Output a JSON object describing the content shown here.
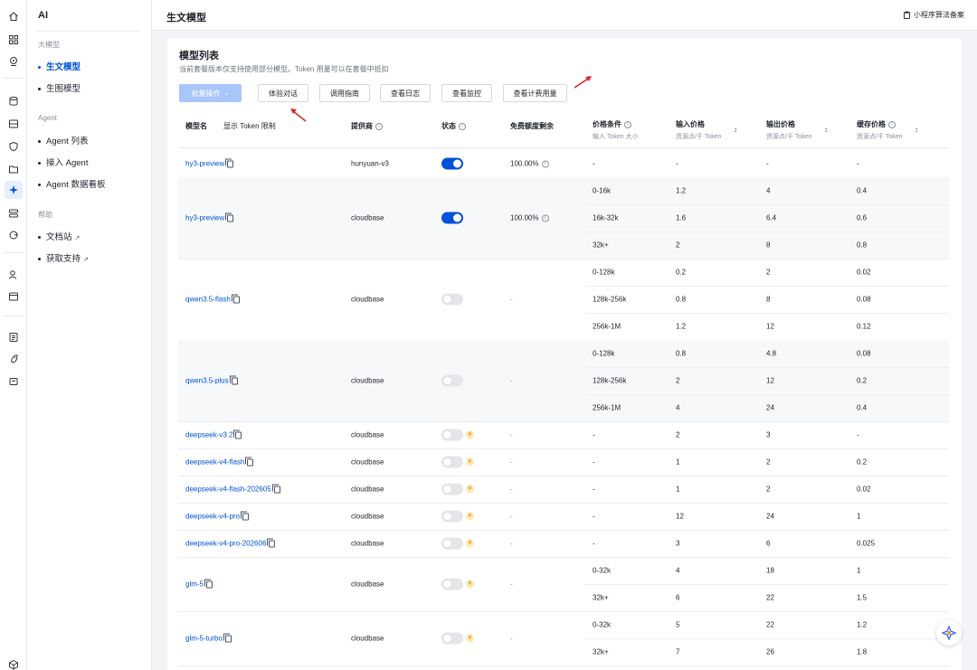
{
  "rail": {
    "icons": [
      "home-icon",
      "grid-icon",
      "location-pin-icon",
      "database-icon",
      "storage-icon",
      "shield-icon",
      "folder-cloud-icon",
      "ai-sparkle-icon",
      "gateway-icon",
      "refresh-link-icon",
      "user-settings-icon",
      "window-icon",
      "document-list-icon",
      "rocket-icon",
      "bag-icon",
      "cube-icon"
    ]
  },
  "sidebar": {
    "title": "AI",
    "groups": [
      {
        "label": "大模型",
        "items": [
          {
            "label": "生文模型",
            "active": true
          },
          {
            "label": "生图模型",
            "active": false
          }
        ]
      },
      {
        "label": "Agent",
        "items": [
          {
            "label": "Agent 列表",
            "active": false
          },
          {
            "label": "接入 Agent",
            "active": false
          },
          {
            "label": "Agent 数据看板",
            "active": false
          }
        ]
      },
      {
        "label": "帮助",
        "items": [
          {
            "label": "文档站",
            "external": true
          },
          {
            "label": "获取支持",
            "external": true
          }
        ]
      }
    ]
  },
  "header": {
    "title": "生文模型",
    "filing_link": "小程序算法备案"
  },
  "card": {
    "title": "模型列表",
    "subtitle": "当前套餐版本仅支持使用部分模型。Token 用量可以在套餐中抵扣",
    "buttons": {
      "batch": "批量操作",
      "chat": "体验对话",
      "guide": "调用指南",
      "logs": "查看日志",
      "monitor": "查看监控",
      "usage": "查看计费用量"
    }
  },
  "table": {
    "headers": {
      "model": "模型名",
      "token_limit": "显示 Token 限制",
      "provider": "提供商",
      "status": "状态",
      "free_quota": "免费额度剩余",
      "price_cond": "价格条件",
      "price_cond_sub": "输入 Token 大小",
      "input_price": "输入价格",
      "input_price_sub": "资源点/千 Token",
      "output_price": "输出价格",
      "output_price_sub": "资源点/千 Token",
      "cache_price": "缓存价格",
      "cache_price_sub": "资源点/千 Token"
    },
    "rows": [
      {
        "model": "hy3-preview",
        "provider": "hunyuan-v3",
        "status": "on",
        "premium": false,
        "quota": "100.00%",
        "tiers": [
          [
            "-",
            "-",
            "-",
            "-"
          ]
        ]
      },
      {
        "model": "hy3-preview",
        "provider": "cloudbase",
        "status": "on",
        "premium": false,
        "quota": "100.00%",
        "tiers": [
          [
            "0-16k",
            "1.2",
            "4",
            "0.4"
          ],
          [
            "16k-32k",
            "1.6",
            "6.4",
            "0.6"
          ],
          [
            "32k+",
            "2",
            "8",
            "0.8"
          ]
        ]
      },
      {
        "model": "qwen3.5-flash",
        "provider": "cloudbase",
        "status": "off",
        "premium": false,
        "quota": "-",
        "tiers": [
          [
            "0-128k",
            "0.2",
            "2",
            "0.02"
          ],
          [
            "128k-256k",
            "0.8",
            "8",
            "0.08"
          ],
          [
            "256k-1M",
            "1.2",
            "12",
            "0.12"
          ]
        ]
      },
      {
        "model": "qwen3.5-plus",
        "provider": "cloudbase",
        "status": "off",
        "premium": false,
        "quota": "-",
        "tiers": [
          [
            "0-128k",
            "0.8",
            "4.8",
            "0.08"
          ],
          [
            "128k-256k",
            "2",
            "12",
            "0.2"
          ],
          [
            "256k-1M",
            "4",
            "24",
            "0.4"
          ]
        ]
      },
      {
        "model": "deepseek-v3.2",
        "provider": "cloudbase",
        "status": "off",
        "premium": true,
        "quota": "-",
        "tiers": [
          [
            "-",
            "2",
            "3",
            "-"
          ]
        ]
      },
      {
        "model": "deepseek-v4-flash",
        "provider": "cloudbase",
        "status": "off",
        "premium": true,
        "quota": "-",
        "tiers": [
          [
            "-",
            "1",
            "2",
            "0.2"
          ]
        ]
      },
      {
        "model": "deepseek-v4-flash-202605",
        "provider": "cloudbase",
        "status": "off",
        "premium": true,
        "quota": "-",
        "tiers": [
          [
            "-",
            "1",
            "2",
            "0.02"
          ]
        ]
      },
      {
        "model": "deepseek-v4-pro",
        "provider": "cloudbase",
        "status": "off",
        "premium": true,
        "quota": "-",
        "tiers": [
          [
            "-",
            "12",
            "24",
            "1"
          ]
        ]
      },
      {
        "model": "deepseek-v4-pro-202606",
        "provider": "cloudbase",
        "status": "off",
        "premium": true,
        "quota": "-",
        "tiers": [
          [
            "-",
            "3",
            "6",
            "0.025"
          ]
        ]
      },
      {
        "model": "glm-5",
        "provider": "cloudbase",
        "status": "off",
        "premium": true,
        "quota": "-",
        "tiers": [
          [
            "0-32k",
            "4",
            "18",
            "1"
          ],
          [
            "32k+",
            "6",
            "22",
            "1.5"
          ]
        ]
      },
      {
        "model": "glm-5-turbo",
        "provider": "cloudbase",
        "status": "off",
        "premium": true,
        "quota": "-",
        "tiers": [
          [
            "0-32k",
            "5",
            "22",
            "1.2"
          ],
          [
            "32k+",
            "7",
            "26",
            "1.8"
          ]
        ]
      }
    ]
  },
  "colors": {
    "accent": "#0052d9",
    "annotation_arrow": "#d92b2b"
  }
}
